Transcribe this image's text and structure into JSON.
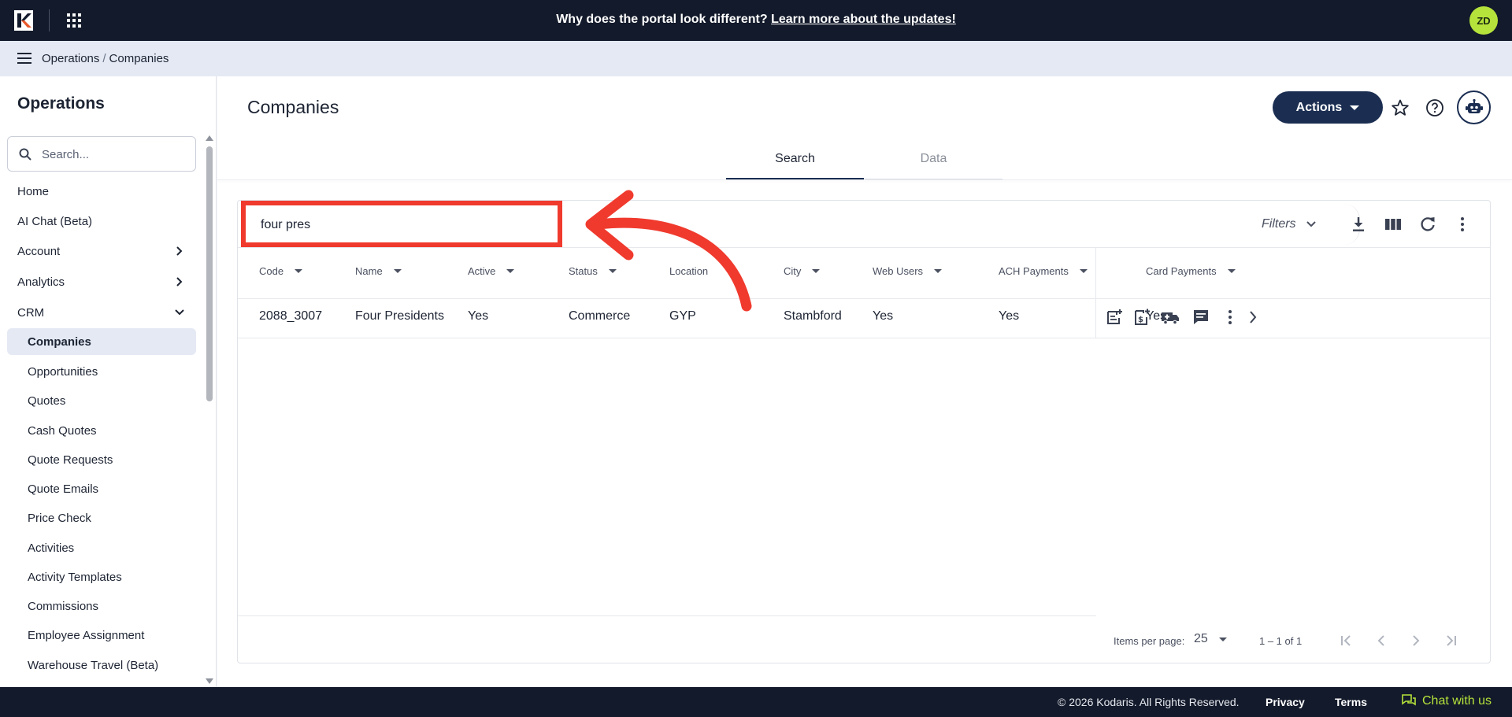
{
  "topbar": {
    "banner_text": "Why does the portal look different?",
    "banner_link": "Learn more about the updates!",
    "avatar_initials": "ZD",
    "accent_color": "#b6e33b"
  },
  "breadcrumb": {
    "items": [
      "Operations",
      "Companies"
    ],
    "separator": "/"
  },
  "sidebar": {
    "title": "Operations",
    "search_placeholder": "Search...",
    "items": [
      {
        "label": "Home"
      },
      {
        "label": "AI Chat (Beta)"
      },
      {
        "label": "Account",
        "expandable": true
      },
      {
        "label": "Analytics",
        "expandable": true
      },
      {
        "label": "CRM",
        "expanded": true
      }
    ],
    "crm_items": [
      "Companies",
      "Opportunities",
      "Quotes",
      "Cash Quotes",
      "Quote Requests",
      "Quote Emails",
      "Price Check",
      "Activities",
      "Activity Templates",
      "Commissions",
      "Employee Assignment",
      "Warehouse Travel (Beta)"
    ],
    "active_item": "Companies"
  },
  "main": {
    "title": "Companies",
    "actions_label": "Actions",
    "tabs": [
      {
        "label": "Search",
        "active": true
      },
      {
        "label": "Data",
        "active": false
      }
    ]
  },
  "table": {
    "search_value": "four pres",
    "filters_label": "Filters",
    "columns": [
      "Code",
      "Name",
      "Active",
      "Status",
      "Location",
      "City",
      "Web Users",
      "ACH Payments",
      "Card Payments"
    ],
    "rows": [
      {
        "cells": [
          "2088_3007",
          "Four Presidents",
          "Yes",
          "Commerce",
          "GYP",
          "Stambford",
          "Yes",
          "Yes",
          "Yes"
        ]
      }
    ],
    "items_per_page_label": "Items per page:",
    "items_per_page": "25",
    "range": "1 – 1 of 1"
  },
  "annotation": {
    "highlight_color": "#f03a2e"
  },
  "footer": {
    "copyright": "© 2026 Kodaris. All Rights Reserved.",
    "privacy": "Privacy",
    "terms": "Terms",
    "chat": "Chat with us"
  }
}
